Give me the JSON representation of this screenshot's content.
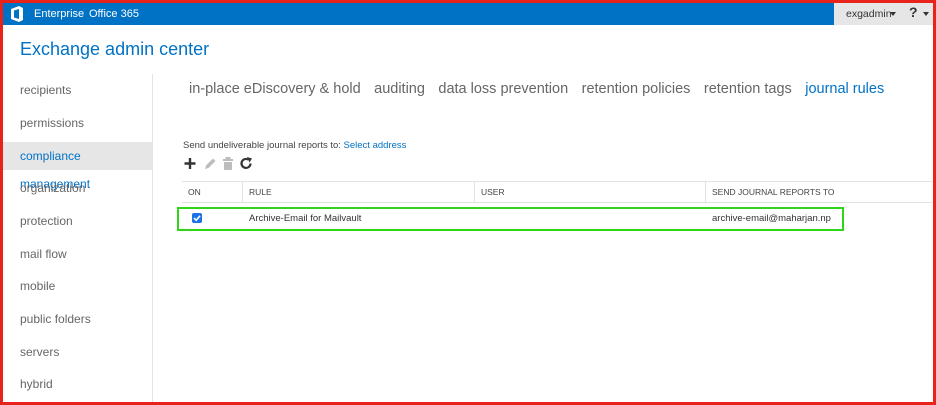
{
  "topbar": {
    "nav": [
      "Enterprise",
      "Office 365"
    ],
    "user": "exgadmin",
    "help": "?"
  },
  "app_title": "Exchange admin center",
  "sidebar": {
    "items": [
      {
        "label": "recipients"
      },
      {
        "label": "permissions"
      },
      {
        "label": "compliance management",
        "active": true
      },
      {
        "label": "organization"
      },
      {
        "label": "protection"
      },
      {
        "label": "mail flow"
      },
      {
        "label": "mobile"
      },
      {
        "label": "public folders"
      },
      {
        "label": "servers"
      },
      {
        "label": "hybrid"
      }
    ]
  },
  "tabs": [
    {
      "label": "in-place eDiscovery & hold"
    },
    {
      "label": "auditing"
    },
    {
      "label": "data loss prevention"
    },
    {
      "label": "retention policies"
    },
    {
      "label": "retention tags"
    },
    {
      "label": "journal rules",
      "active": true
    }
  ],
  "undeliverable": {
    "text": "Send undeliverable journal reports to:",
    "link": "Select address"
  },
  "toolbar": {
    "icons": [
      "add-icon",
      "edit-icon",
      "delete-icon",
      "refresh-icon"
    ]
  },
  "grid": {
    "columns": [
      "ON",
      "RULE",
      "USER",
      "SEND JOURNAL REPORTS TO"
    ],
    "rows": [
      {
        "on": true,
        "rule": "Archive-Email for Mailvault",
        "user": "",
        "send_to": "archive-email@maharjan.np"
      }
    ]
  },
  "colors": {
    "accent": "#0072c6",
    "frame": "#e8231b",
    "highlight": "#2fd617"
  }
}
